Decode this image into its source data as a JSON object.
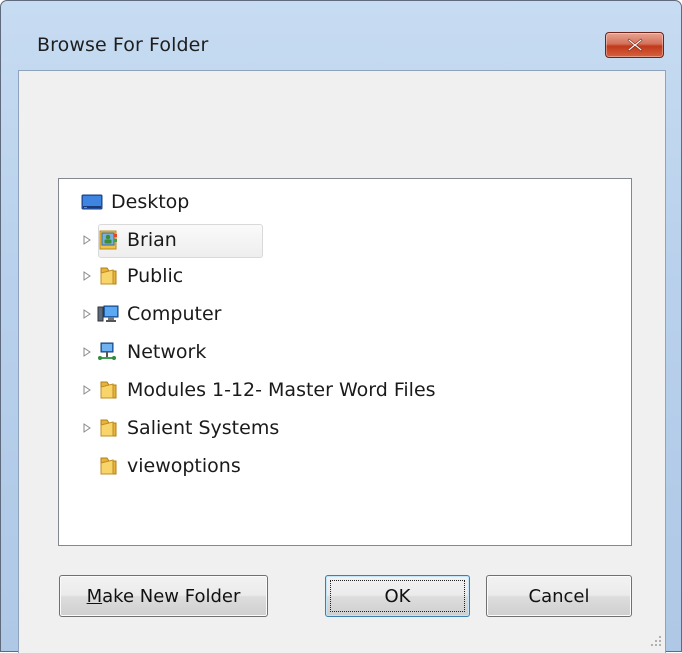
{
  "window": {
    "title": "Browse For Folder"
  },
  "tree": {
    "items": [
      {
        "label": "Desktop",
        "icon": "desktop-icon",
        "has_expander": false,
        "selected": false
      },
      {
        "label": "Brian",
        "icon": "user-folder-icon",
        "has_expander": true,
        "selected": true
      },
      {
        "label": "Public",
        "icon": "folder-icon",
        "has_expander": true,
        "selected": false
      },
      {
        "label": "Computer",
        "icon": "computer-icon",
        "has_expander": true,
        "selected": false
      },
      {
        "label": "Network",
        "icon": "network-icon",
        "has_expander": true,
        "selected": false
      },
      {
        "label": "Modules 1-12- Master Word Files",
        "icon": "folder-icon",
        "has_expander": true,
        "selected": false
      },
      {
        "label": "Salient Systems",
        "icon": "folder-icon",
        "has_expander": true,
        "selected": false
      },
      {
        "label": "viewoptions",
        "icon": "folder-icon",
        "has_expander": false,
        "selected": false
      }
    ]
  },
  "buttons": {
    "make_new_folder_mnemonic": "M",
    "make_new_folder_rest": "ake New Folder",
    "ok": "OK",
    "cancel": "Cancel"
  },
  "colors": {
    "frame": "#b9d1ec",
    "close_button": "#c0391b",
    "client": "#f0f0f0",
    "folder": "#e8b33c"
  }
}
